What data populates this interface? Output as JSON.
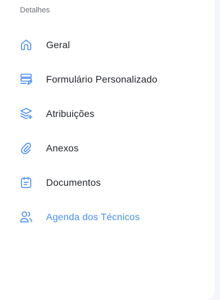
{
  "section": {
    "title": "Detalhes"
  },
  "menu": {
    "items": [
      {
        "label": "Geral",
        "icon": "home-icon",
        "active": false
      },
      {
        "label": "Formulário Personalizado",
        "icon": "form-edit-icon",
        "active": false
      },
      {
        "label": "Atribuições",
        "icon": "layers-plus-icon",
        "active": false
      },
      {
        "label": "Anexos",
        "icon": "paperclip-icon",
        "active": false
      },
      {
        "label": "Documentos",
        "icon": "calendar-document-icon",
        "active": false
      },
      {
        "label": "Agenda dos Técnicos",
        "icon": "users-icon",
        "active": true
      }
    ]
  },
  "colors": {
    "accent": "#4a8ff0",
    "text": "#1f2329",
    "muted": "#6b6f76",
    "background": "#f4f6f9",
    "panel": "#ffffff"
  }
}
